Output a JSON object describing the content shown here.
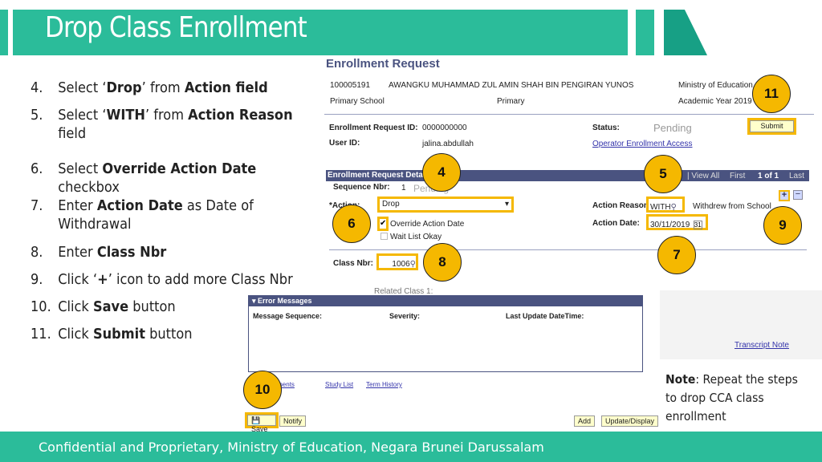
{
  "slide": {
    "title": "Drop Class Enrollment",
    "accent": "#2bbc9a",
    "accent_dark": "#17a085",
    "badge_color": "#f5b800",
    "steps": [
      {
        "num": "4.",
        "parts": [
          "Select ‘",
          "Drop",
          "’ from ",
          "Action field"
        ]
      },
      {
        "num": "5.",
        "parts": [
          "Select ‘",
          "WITH",
          "’ from ",
          "Action Reason"
        ],
        "line2": "field"
      },
      {
        "num": "6.",
        "parts": [
          "Select ",
          "Override Action Date"
        ],
        "line2": "checkbox"
      },
      {
        "num": "7.",
        "parts": [
          "Enter ",
          "Action Date",
          " as Date of"
        ],
        "line2": "Withdrawal"
      },
      {
        "num": "8.",
        "parts": [
          "Enter ",
          "Class Nbr"
        ]
      },
      {
        "num": "9.",
        "parts": [
          "Click ‘",
          "+",
          "’ icon to add more Class Nbr"
        ]
      },
      {
        "num": "10.",
        "parts": [
          "Click ",
          "Save",
          " button"
        ]
      },
      {
        "num": "11.",
        "parts": [
          "Click ",
          "Submit",
          " button"
        ]
      }
    ],
    "note_label": "Note",
    "note_text": ": Repeat the steps to drop CCA class enrollment",
    "footer": "Confidential and Proprietary, Ministry of Education, Negara Brunei Darussalam"
  },
  "screen": {
    "heading": "Enrollment Request",
    "student_id": "100005191",
    "student_name": "AWANGKU MUHAMMAD ZUL AMIN SHAH BIN PENGIRAN YUNOS",
    "institution": "Ministry of Education",
    "career": "Primary School",
    "program": "Primary",
    "term": "Academic Year 2019",
    "req_id_label": "Enrollment Request ID:",
    "req_id": "0000000000",
    "status_label": "Status:",
    "status": "Pending",
    "user_label": "User ID:",
    "user": "jalina.abdullah",
    "operator_link": "Operator Enrollment Access",
    "submit": "Submit",
    "detail_title": "Enrollment Request Detail",
    "view_all": "| View All",
    "first": "First",
    "pager": "1 of 1",
    "last": "Last",
    "seq_label": "Sequence Nbr:",
    "seq": "1",
    "seq_status": "Pending",
    "action_label": "*Action:",
    "action": "Drop",
    "reason_label": "Action Reason",
    "reason": "WITH",
    "reason_desc": "Withdrew from School",
    "override_label": "Override Action Date",
    "waitlist_label": "Wait List Okay",
    "date_label": "Action Date:",
    "date": "30/11/2019",
    "class_label": "Class Nbr:",
    "class_nbr": "1006",
    "related_label": "Related Class 1:",
    "errors_title": "▾ Error Messages",
    "col1": "Message Sequence:",
    "col2": "Severity:",
    "col3": "Last Update DateTime:",
    "transcript": "Transcript Note",
    "links": [
      "Appointments",
      "Study List",
      "Term History"
    ],
    "save": "Save",
    "notify": "Notify",
    "add": "Add",
    "update": "Update/Display"
  },
  "badges": [
    "11",
    "4",
    "5",
    "6",
    "9",
    "7",
    "8",
    "10"
  ]
}
